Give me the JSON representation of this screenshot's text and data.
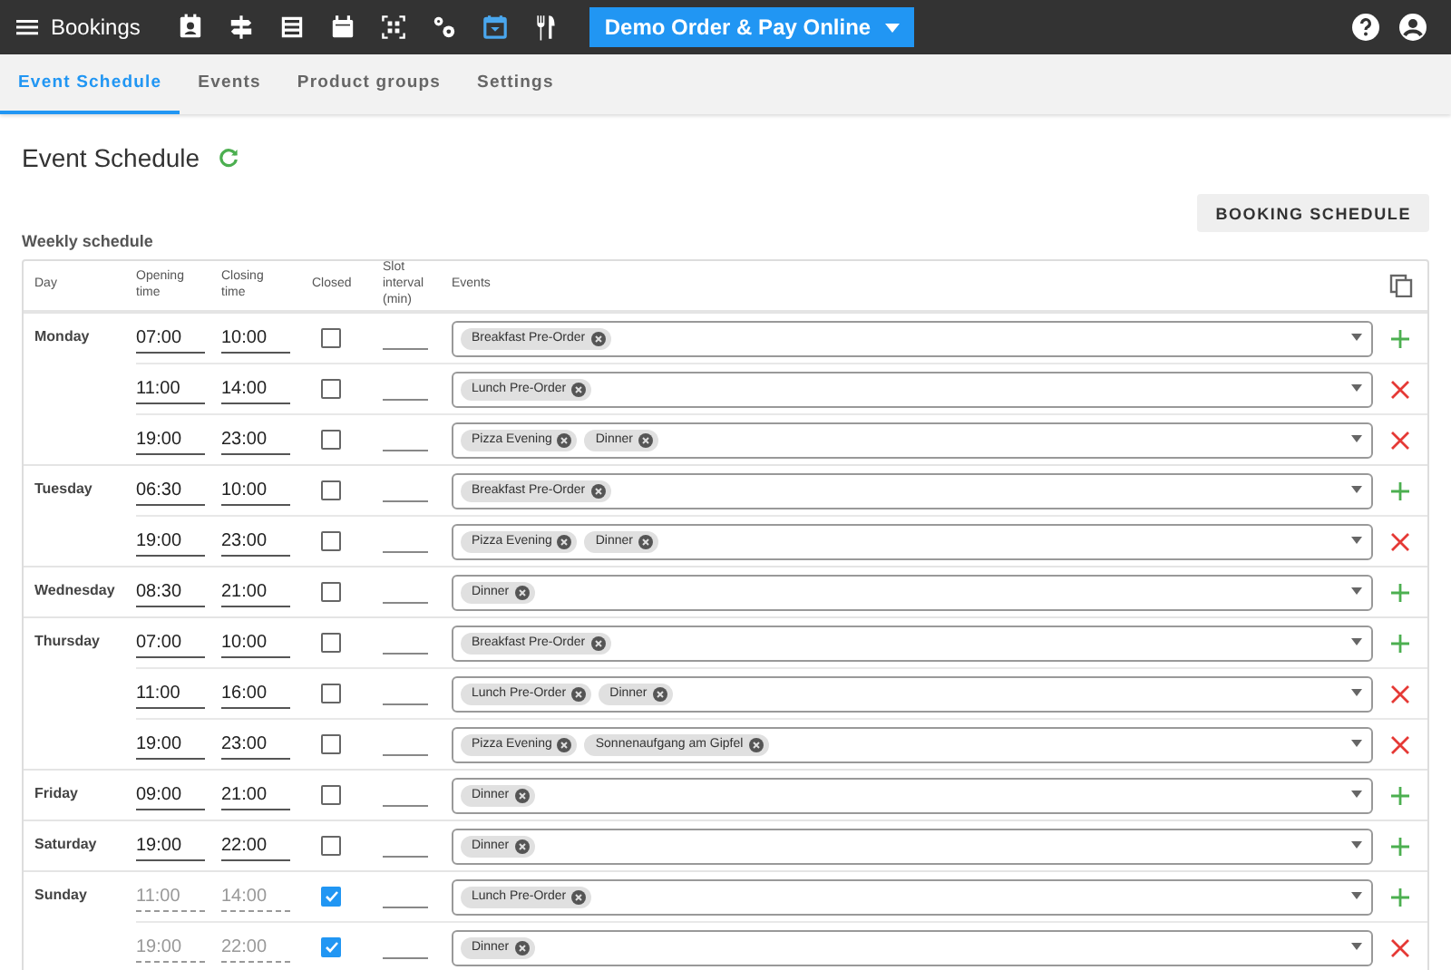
{
  "topbar": {
    "title": "Bookings",
    "icons": [
      {
        "kind": "contact",
        "selected": false
      },
      {
        "kind": "signpost",
        "selected": false
      },
      {
        "kind": "list",
        "selected": false
      },
      {
        "kind": "calendar",
        "selected": false
      },
      {
        "kind": "qr",
        "selected": false
      },
      {
        "kind": "gears",
        "selected": false
      },
      {
        "kind": "event",
        "selected": true
      },
      {
        "kind": "cutlery",
        "selected": false
      }
    ],
    "location": "Demo Order & Pay Online"
  },
  "tabs": [
    {
      "label": "Event Schedule",
      "selected": true
    },
    {
      "label": "Events",
      "selected": false
    },
    {
      "label": "Product groups",
      "selected": false
    },
    {
      "label": "Settings",
      "selected": false
    }
  ],
  "page": {
    "title": "Event Schedule",
    "button": "BOOKING SCHEDULE",
    "section": "Weekly schedule"
  },
  "table": {
    "columns": [
      "Day",
      "Opening time",
      "Closing time",
      "Closed",
      "Slot interval (min)",
      "Events"
    ],
    "days": [
      {
        "day": "Monday",
        "slots": [
          {
            "open": "07:00",
            "close": "10:00",
            "closed": false,
            "events": [
              "Breakfast Pre-Order"
            ],
            "kind": "add"
          },
          {
            "open": "11:00",
            "close": "14:00",
            "closed": false,
            "events": [
              "Lunch Pre-Order"
            ],
            "kind": "remove"
          },
          {
            "open": "19:00",
            "close": "23:00",
            "closed": false,
            "events": [
              "Pizza Evening",
              "Dinner"
            ],
            "kind": "remove"
          }
        ]
      },
      {
        "day": "Tuesday",
        "slots": [
          {
            "open": "06:30",
            "close": "10:00",
            "closed": false,
            "events": [
              "Breakfast Pre-Order"
            ],
            "kind": "add"
          },
          {
            "open": "19:00",
            "close": "23:00",
            "closed": false,
            "events": [
              "Pizza Evening",
              "Dinner"
            ],
            "kind": "remove"
          }
        ]
      },
      {
        "day": "Wednesday",
        "slots": [
          {
            "open": "08:30",
            "close": "21:00",
            "closed": false,
            "events": [
              "Dinner"
            ],
            "kind": "add"
          }
        ]
      },
      {
        "day": "Thursday",
        "slots": [
          {
            "open": "07:00",
            "close": "10:00",
            "closed": false,
            "events": [
              "Breakfast Pre-Order"
            ],
            "kind": "add"
          },
          {
            "open": "11:00",
            "close": "16:00",
            "closed": false,
            "events": [
              "Lunch Pre-Order",
              "Dinner"
            ],
            "kind": "remove"
          },
          {
            "open": "19:00",
            "close": "23:00",
            "closed": false,
            "events": [
              "Pizza Evening",
              "Sonnenaufgang am Gipfel"
            ],
            "kind": "remove"
          }
        ]
      },
      {
        "day": "Friday",
        "slots": [
          {
            "open": "09:00",
            "close": "21:00",
            "closed": false,
            "events": [
              "Dinner"
            ],
            "kind": "add"
          }
        ]
      },
      {
        "day": "Saturday",
        "slots": [
          {
            "open": "19:00",
            "close": "22:00",
            "closed": false,
            "events": [
              "Dinner"
            ],
            "kind": "add"
          }
        ]
      },
      {
        "day": "Sunday",
        "slots": [
          {
            "open": "11:00",
            "close": "14:00",
            "closed": true,
            "events": [
              "Lunch Pre-Order"
            ],
            "kind": "add"
          },
          {
            "open": "19:00",
            "close": "22:00",
            "closed": true,
            "events": [
              "Dinner"
            ],
            "kind": "remove"
          }
        ]
      }
    ]
  }
}
